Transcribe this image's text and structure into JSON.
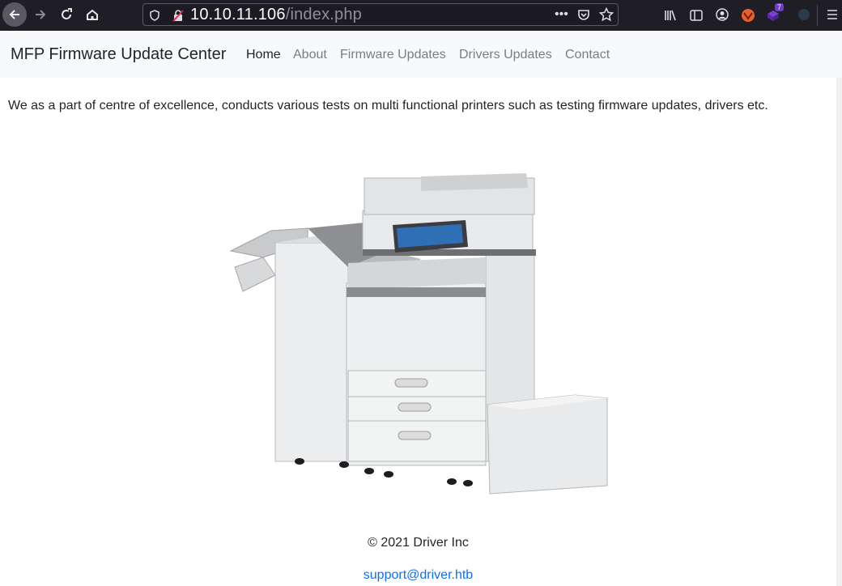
{
  "browser": {
    "url_host": "10.10.11.106",
    "url_path": "/index.php",
    "extension_badge": "7"
  },
  "navbar": {
    "brand": "MFP Firmware Update Center",
    "links": [
      "Home",
      "About",
      "Firmware Updates",
      "Drivers Updates",
      "Contact"
    ],
    "active": "Home"
  },
  "main": {
    "intro": "We as a part of centre of excellence, conducts various tests on multi functional printers such as testing firmware updates, drivers etc."
  },
  "footer": {
    "copyright": "© 2021 Driver Inc",
    "email": "support@driver.htb"
  }
}
